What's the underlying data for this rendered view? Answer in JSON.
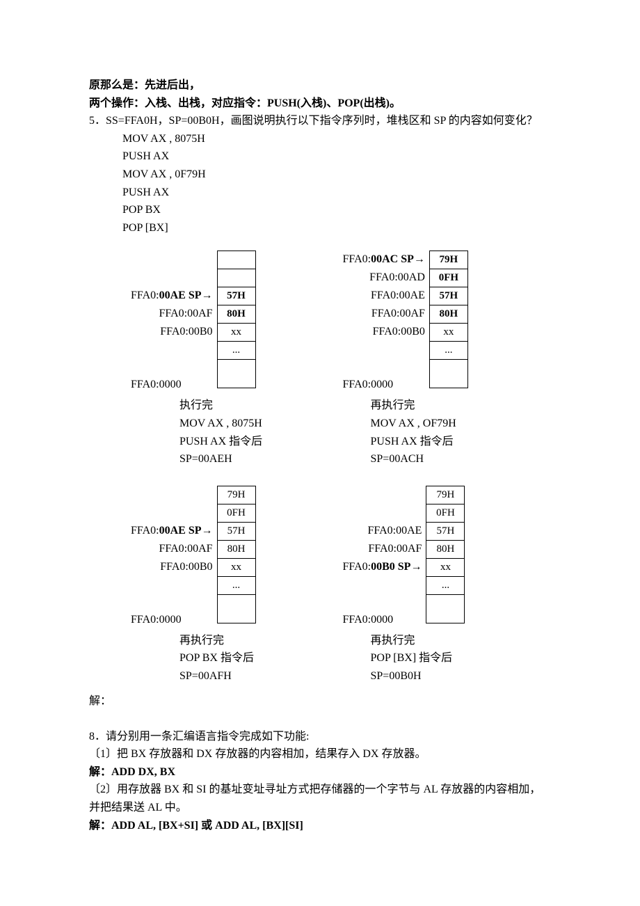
{
  "intro": {
    "l1": "原那么是：先进后出，",
    "l2": "两个操作：入栈、出栈，对应指令：PUSH(入栈)、POP(出栈)。",
    "l3_a": "5．SS=FFA0H，SP=00B0H，画图说明执行以下指令序列时，堆栈区和 SP 的内容如何变化？",
    "code": [
      "MOV AX , 8075H",
      "PUSH AX",
      "MOV AX , 0F79H",
      "PUSH AX",
      "POP BX",
      "POP [BX]"
    ]
  },
  "diag1": {
    "addrs": {
      "a1_pre": "FFA0:",
      "a1_b": "00AE SP→",
      "a2": "FFA0:00AF",
      "a3": "FFA0:00B0",
      "a_end": "FFA0:0000"
    },
    "cells": {
      "c1": "57H",
      "c2": "80H",
      "c3": "xx",
      "c4": "..."
    },
    "cap1": "执行完",
    "cap2": "MOV AX , 8075H",
    "cap3": "PUSH AX  指令后",
    "cap4": "SP=00AEH"
  },
  "diag2": {
    "addrs": {
      "a1_pre": "FFA0:",
      "a1_b": "00AC SP→",
      "a2": "FFA0:00AD",
      "a3": "FFA0:00AE",
      "a4": "FFA0:00AF",
      "a5": "FFA0:00B0",
      "a_end": "FFA0:0000"
    },
    "cells": {
      "c1": "79H",
      "c2": "0FH",
      "c3": "57H",
      "c4": "80H",
      "c5": "xx",
      "c6": "..."
    },
    "cap1": "再执行完",
    "cap2": "MOV AX , OF79H",
    "cap3": "PUSH AX  指令后",
    "cap4": "SP=00ACH"
  },
  "diag3": {
    "addrs": {
      "a1_pre": "FFA0:",
      "a1_b": "00AE SP→",
      "a2": "FFA0:00AF",
      "a3": "FFA0:00B0",
      "a_end": "FFA0:0000"
    },
    "cells": {
      "c1": "79H",
      "c2": "0FH",
      "c3": "57H",
      "c4": "80H",
      "c5": "xx",
      "c6": "..."
    },
    "cap1": "再执行完",
    "cap2": "POP BX 指令后",
    "cap3": "SP=00AFH"
  },
  "diag4": {
    "addrs": {
      "a1": "FFA0:00AE",
      "a2": "FFA0:00AF",
      "a3_pre": "FFA0:",
      "a3_b": "00B0 SP→",
      "a_end": "FFA0:0000"
    },
    "cells": {
      "c1": "79H",
      "c2": "0FH",
      "c3": "57H",
      "c4": "80H",
      "c5": "xx",
      "c6": "..."
    },
    "cap1": "再执行完",
    "cap2": "POP [BX]  指令后",
    "cap3": "SP=00B0H"
  },
  "outro": {
    "jie": "解：",
    "q8": "8．请分别用一条汇编语言指令完成如下功能:",
    "q8_1": "〔1〕把 BX 存放器和 DX 存放器的内容相加，结果存入 DX 存放器。",
    "a8_1": "解：ADD DX, BX",
    "q8_2a": "〔2〕用存放器 BX 和 SI 的基址变址寻址方式把存储器的一个字节与 AL 存放器的内容相加，",
    "q8_2b": "并把结果送 AL 中。",
    "a8_2": "解：ADD AL, [BX+SI]    或 ADD AL, [BX][SI]"
  }
}
